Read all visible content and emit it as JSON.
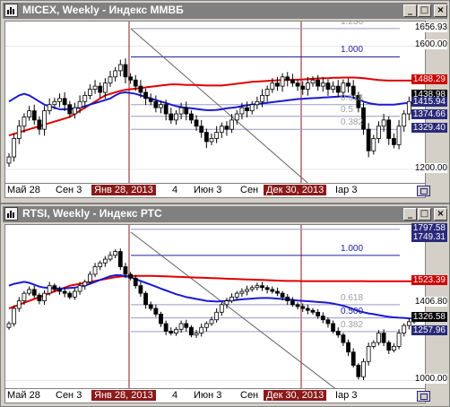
{
  "windows": [
    {
      "title": "MICEX, Weekly - Индекс ММВБ",
      "controls": {
        "minimize": "_",
        "maximize": "□",
        "close": "×"
      },
      "x_labels": [
        {
          "text": "Май 28",
          "hl": false
        },
        {
          "text": "Сен 3",
          "hl": false
        },
        {
          "text": "Янв 28, 2013",
          "hl": true
        },
        {
          "text": "4",
          "hl": false
        },
        {
          "text": "Июн 3",
          "hl": false
        },
        {
          "text": "Сен",
          "hl": false
        },
        {
          "text": "Дек 30, 2013",
          "hl": true
        },
        {
          "text": "Iар 3",
          "hl": false
        }
      ],
      "price_labels": [
        {
          "text": "1656.93",
          "style": "plain"
        },
        {
          "text": "1600.00",
          "style": "plain"
        },
        {
          "text": "1488.29",
          "style": "red"
        },
        {
          "text": "1438.98",
          "style": "black"
        },
        {
          "text": "1415.94",
          "style": "dark"
        },
        {
          "text": "1374.66",
          "style": "dark"
        },
        {
          "text": "1329.40",
          "style": "dark"
        },
        {
          "text": "1200.00",
          "style": "plain"
        }
      ],
      "fib_labels": [
        {
          "text": "1.236",
          "faint": true
        },
        {
          "text": "1.000",
          "faint": false
        },
        {
          "text": "0.618",
          "faint": true
        },
        {
          "text": "0.5",
          "faint": true
        },
        {
          "text": "0.382",
          "faint": true
        }
      ],
      "chart_data": {
        "type": "candlestick",
        "timeframe": "Weekly",
        "y_ticks": [
          1200,
          1600
        ],
        "ylim": [
          1150,
          1680
        ],
        "markers": {
          "last_close": 1438.98,
          "ma_red": 1488.29,
          "levels": [
            1656.93,
            1415.94,
            1374.66,
            1329.4
          ]
        },
        "fib_levels": [
          {
            "ratio": "1.236",
            "value": 1656.93
          },
          {
            "ratio": "1.000",
            "value": 1565
          },
          {
            "ratio": "0.618",
            "value": 1410
          },
          {
            "ratio": "0.5",
            "value": 1372
          },
          {
            "ratio": "0.382",
            "value": 1330
          }
        ],
        "closes": [
          1240,
          1300,
          1340,
          1370,
          1390,
          1360,
          1330,
          1390,
          1410,
          1420,
          1430,
          1410,
          1380,
          1400,
          1420,
          1440,
          1460,
          1470,
          1450,
          1480,
          1500,
          1520,
          1540,
          1500,
          1490,
          1470,
          1450,
          1430,
          1420,
          1400,
          1410,
          1380,
          1360,
          1380,
          1400,
          1380,
          1360,
          1340,
          1320,
          1290,
          1300,
          1320,
          1340,
          1330,
          1360,
          1380,
          1400,
          1390,
          1410,
          1420,
          1440,
          1460,
          1480,
          1470,
          1500,
          1490,
          1480,
          1470,
          1460,
          1480,
          1490,
          1470,
          1480,
          1460,
          1470,
          1450,
          1480,
          1470,
          1440,
          1400,
          1330,
          1260,
          1300,
          1340,
          1360,
          1300,
          1280,
          1340,
          1380,
          1420,
          1439
        ],
        "ma_red": [
          1310,
          1315,
          1320,
          1325,
          1330,
          1335,
          1340,
          1345,
          1350,
          1355,
          1360,
          1365,
          1370,
          1380,
          1390,
          1400,
          1410,
          1420,
          1430,
          1440,
          1445,
          1450,
          1455,
          1458,
          1460,
          1462,
          1464,
          1466,
          1468,
          1470,
          1472,
          1474,
          1476,
          1476,
          1475,
          1474,
          1474,
          1474,
          1473,
          1472,
          1472,
          1472,
          1472,
          1474,
          1476,
          1478,
          1480,
          1482,
          1484,
          1485,
          1486,
          1487,
          1488,
          1489,
          1490,
          1490,
          1491,
          1491,
          1492,
          1493,
          1494,
          1495,
          1496,
          1496,
          1497,
          1497,
          1498,
          1498,
          1498,
          1497,
          1496,
          1494,
          1492,
          1490,
          1489,
          1488,
          1488,
          1488,
          1488,
          1488,
          1488
        ],
        "ma_blue": [
          1420,
          1430,
          1440,
          1445,
          1440,
          1430,
          1420,
          1410,
          1405,
          1400,
          1395,
          1395,
          1396,
          1398,
          1400,
          1405,
          1410,
          1415,
          1420,
          1425,
          1430,
          1440,
          1448,
          1450,
          1448,
          1445,
          1440,
          1435,
          1430,
          1425,
          1420,
          1415,
          1410,
          1405,
          1402,
          1400,
          1398,
          1396,
          1394,
          1392,
          1392,
          1393,
          1395,
          1398,
          1400,
          1402,
          1405,
          1408,
          1410,
          1412,
          1414,
          1416,
          1418,
          1420,
          1422,
          1424,
          1426,
          1428,
          1429,
          1430,
          1431,
          1432,
          1433,
          1434,
          1435,
          1436,
          1437,
          1436,
          1433,
          1428,
          1420,
          1415,
          1412,
          1410,
          1410,
          1410,
          1410,
          1412,
          1414,
          1415,
          1416
        ]
      }
    },
    {
      "title": "RTSI, Weekly - Индекс РТС",
      "controls": {
        "minimize": "_",
        "maximize": "□",
        "close": "×"
      },
      "x_labels": [
        {
          "text": "Май 28",
          "hl": false
        },
        {
          "text": "Сен 3",
          "hl": false
        },
        {
          "text": "Янв 28, 2013",
          "hl": true
        },
        {
          "text": "4",
          "hl": false
        },
        {
          "text": "Июн 3",
          "hl": false
        },
        {
          "text": "Сен",
          "hl": false
        },
        {
          "text": "Дек 30, 2013",
          "hl": true
        },
        {
          "text": "Iар 3",
          "hl": false
        }
      ],
      "price_labels": [
        {
          "text": "1797.58",
          "style": "dark"
        },
        {
          "text": "1749.31",
          "style": "dark"
        },
        {
          "text": "1523.39",
          "style": "red"
        },
        {
          "text": "1406.80",
          "style": "plain"
        },
        {
          "text": "1326.58",
          "style": "black"
        },
        {
          "text": "1257.96",
          "style": "dark"
        },
        {
          "text": "1000.00",
          "style": "plain"
        }
      ],
      "fib_labels": [
        {
          "text": "1.236",
          "faint": true
        },
        {
          "text": "1.000",
          "faint": false
        },
        {
          "text": "0.618",
          "faint": true
        },
        {
          "text": "0.500",
          "faint": false
        },
        {
          "text": "0.382",
          "faint": true
        }
      ],
      "chart_data": {
        "type": "candlestick",
        "timeframe": "Weekly",
        "y_ticks": [
          1000
        ],
        "ylim": [
          950,
          1820
        ],
        "markers": {
          "last_close": 1326.58,
          "ma_red": 1523.39,
          "levels": [
            1797.58,
            1749.31,
            1406.8,
            1257.96
          ]
        },
        "fib_levels": [
          {
            "ratio": "1.236",
            "value": 1797.58
          },
          {
            "ratio": "1.000",
            "value": 1660
          },
          {
            "ratio": "0.618",
            "value": 1400
          },
          {
            "ratio": "0.500",
            "value": 1330
          },
          {
            "ratio": "0.382",
            "value": 1257.96
          }
        ],
        "closes": [
          1300,
          1380,
          1420,
          1460,
          1480,
          1450,
          1420,
          1460,
          1500,
          1480,
          1470,
          1460,
          1440,
          1470,
          1500,
          1520,
          1560,
          1600,
          1620,
          1640,
          1660,
          1680,
          1600,
          1560,
          1540,
          1500,
          1460,
          1400,
          1380,
          1350,
          1300,
          1260,
          1250,
          1270,
          1300,
          1280,
          1240,
          1250,
          1280,
          1300,
          1320,
          1360,
          1400,
          1420,
          1440,
          1460,
          1470,
          1480,
          1490,
          1500,
          1490,
          1480,
          1470,
          1460,
          1440,
          1420,
          1400,
          1390,
          1380,
          1370,
          1360,
          1340,
          1320,
          1300,
          1260,
          1240,
          1200,
          1150,
          1080,
          1020,
          1100,
          1180,
          1200,
          1250,
          1200,
          1160,
          1180,
          1250,
          1290,
          1310,
          1327
        ],
        "ma_red": [
          1380,
          1390,
          1400,
          1410,
          1420,
          1430,
          1440,
          1450,
          1460,
          1470,
          1480,
          1490,
          1500,
          1505,
          1510,
          1515,
          1520,
          1525,
          1530,
          1535,
          1540,
          1545,
          1548,
          1550,
          1551,
          1552,
          1552,
          1552,
          1552,
          1551,
          1550,
          1549,
          1548,
          1547,
          1546,
          1545,
          1544,
          1543,
          1542,
          1541,
          1540,
          1539,
          1538,
          1537,
          1536,
          1535,
          1534,
          1533,
          1532,
          1531,
          1530,
          1529,
          1528,
          1527,
          1526,
          1525,
          1525,
          1525,
          1524,
          1524,
          1524,
          1524,
          1524,
          1524,
          1524,
          1524,
          1524,
          1524,
          1524,
          1524,
          1524,
          1523,
          1523,
          1523,
          1523,
          1523,
          1523,
          1523,
          1523,
          1523,
          1523
        ],
        "ma_blue": [
          1500,
          1510,
          1515,
          1520,
          1515,
          1505,
          1495,
          1490,
          1488,
          1486,
          1485,
          1486,
          1488,
          1490,
          1495,
          1500,
          1510,
          1520,
          1530,
          1540,
          1550,
          1555,
          1555,
          1550,
          1545,
          1535,
          1525,
          1515,
          1505,
          1495,
          1485,
          1475,
          1465,
          1455,
          1448,
          1440,
          1435,
          1430,
          1425,
          1420,
          1418,
          1416,
          1418,
          1420,
          1422,
          1425,
          1428,
          1430,
          1432,
          1434,
          1435,
          1435,
          1434,
          1432,
          1430,
          1428,
          1425,
          1422,
          1420,
          1418,
          1416,
          1414,
          1412,
          1410,
          1406,
          1400,
          1394,
          1386,
          1376,
          1366,
          1360,
          1354,
          1350,
          1345,
          1340,
          1336,
          1333,
          1331,
          1330,
          1328,
          1327
        ]
      }
    }
  ]
}
